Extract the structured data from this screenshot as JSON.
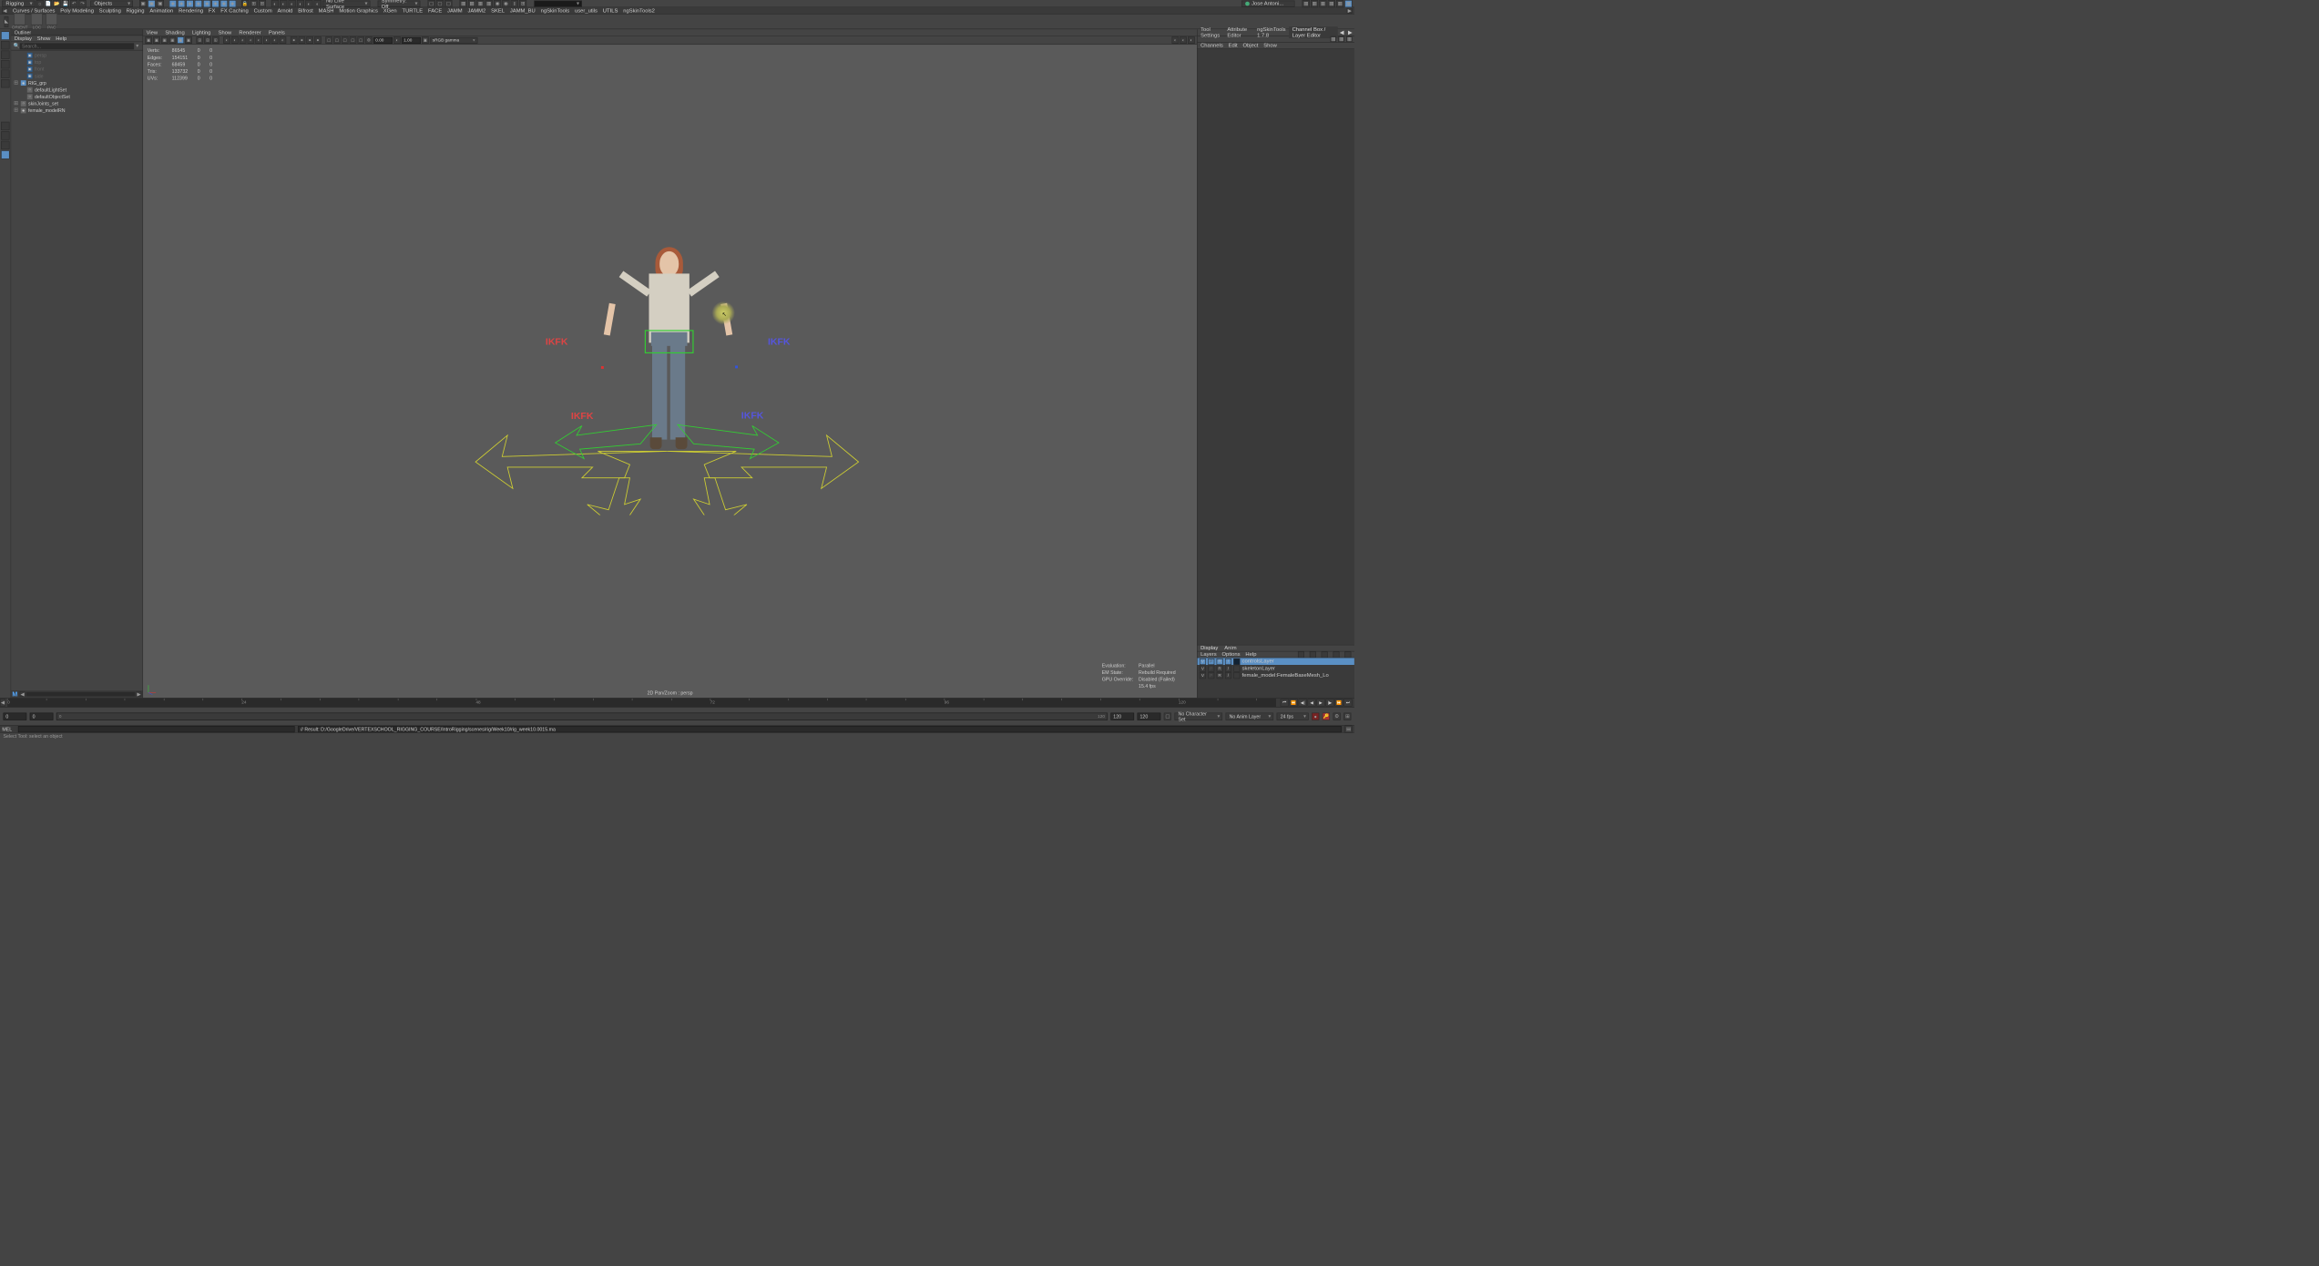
{
  "menubar": {
    "workspace": "Rigging",
    "obj_filter": "Objects",
    "live_surface": "No Live Surface",
    "symmetry": "Symmetry: Off",
    "user": "Jose Antoni..."
  },
  "shelf_tabs": [
    "Curves / Surfaces",
    "Poly Modeling",
    "Sculpting",
    "Rigging",
    "Animation",
    "Rendering",
    "FX",
    "FX Caching",
    "Custom",
    "Arnold",
    "Bifrost",
    "MASH",
    "Motion Graphics",
    "XGen",
    "TURTLE",
    "FACE",
    "JAMM",
    "JAMM2",
    "SKEL",
    "JAMM_BU",
    "ngSkinTools",
    "user_utils",
    "UTILS",
    "ngSkinTools2"
  ],
  "shelf_active": "UTILS",
  "shelf_items": [
    {
      "l": "ORIENT"
    },
    {
      "l": "LOC"
    },
    {
      "l": "PAC"
    }
  ],
  "outliner": {
    "title": "Outliner",
    "menu": [
      "Display",
      "Show",
      "Help"
    ],
    "search_ph": "Search...",
    "items": [
      {
        "ic": "cam",
        "label": "persp",
        "dim": true,
        "ind": 1
      },
      {
        "ic": "cam",
        "label": "top",
        "dim": true,
        "ind": 1
      },
      {
        "ic": "cam",
        "label": "front",
        "dim": true,
        "ind": 1
      },
      {
        "ic": "cam",
        "label": "side",
        "dim": true,
        "ind": 1
      },
      {
        "ic": "grp",
        "label": "RIG_grp",
        "exp": "+",
        "ind": 0
      },
      {
        "ic": "set",
        "label": "defaultLightSet",
        "ind": 1
      },
      {
        "ic": "set",
        "label": "defaultObjectSet",
        "ind": 1
      },
      {
        "ic": "set",
        "label": "skinJoints_set",
        "exp": "+",
        "ind": 0
      },
      {
        "ic": "ref",
        "label": "female_modelRN",
        "exp": "+",
        "ind": 0
      }
    ]
  },
  "viewport": {
    "menu": [
      "View",
      "Shading",
      "Lighting",
      "Show",
      "Renderer",
      "Panels"
    ],
    "near": "0.00",
    "far": "1.00",
    "space": "sRGB gamma",
    "stats": [
      {
        "k": "Verts:",
        "v": "86545",
        "a": "0",
        "b": "0"
      },
      {
        "k": "Edges:",
        "v": "154151",
        "a": "0",
        "b": "0"
      },
      {
        "k": "Faces:",
        "v": "68459",
        "a": "0",
        "b": "0"
      },
      {
        "k": "Tris:",
        "v": "133732",
        "a": "0",
        "b": "0"
      },
      {
        "k": "UVs:",
        "v": "112399",
        "a": "0",
        "b": "0"
      }
    ],
    "ikfk_labels": [
      "IKFK",
      "IKFK",
      "IKFK",
      "IKFK"
    ],
    "eval": [
      {
        "k": "Evaluation:",
        "v": "Parallel"
      },
      {
        "k": "EM State:",
        "v": "Rebuild Required"
      },
      {
        "k": "GPU Override:",
        "v": "Disabled (Failed)"
      }
    ],
    "fps": "15.4 fps",
    "camera": "2D Pan/Zoom : persp"
  },
  "right": {
    "tabs": [
      "Tool Settings",
      "Attribute Editor",
      "ngSkinTools 1.7.8",
      "Channel Box / Layer Editor"
    ],
    "active": 3,
    "menu": [
      "Channels",
      "Edit",
      "Object",
      "Show"
    ]
  },
  "layers": {
    "tabs": [
      "Display",
      "Anim"
    ],
    "active": 0,
    "menu": [
      "Layers",
      "Options",
      "Help"
    ],
    "list": [
      {
        "v": "V",
        "p": "P",
        "r": "R",
        "slash": "/",
        "color": "#1a3a6a",
        "name": "controlsLayer",
        "sel": true
      },
      {
        "v": "V",
        "p": "P",
        "r": "R",
        "slash": "/",
        "color": "",
        "name": "skeletonLayer"
      },
      {
        "v": "V",
        "p": "P",
        "r": "R",
        "slash": "/",
        "color": "",
        "name": "female_model:FemaleBaseMesh_Lo"
      }
    ]
  },
  "timeline": {
    "start": "0",
    "cur": "0",
    "rstart": "0",
    "rend": "120",
    "end": "120",
    "total": "120",
    "charset": "No Character Set",
    "animlayer": "No Anim Layer",
    "fps": "24 fps"
  },
  "cmd": {
    "lang": "MEL",
    "result": "// Result: D:/GoogleDrive/VERTEXSCHOOL_RIGGING_COURSE/IntroRigging/scenes/rig/Week10/rig_week10.0015.ma"
  },
  "help": "Select Tool: select an object"
}
